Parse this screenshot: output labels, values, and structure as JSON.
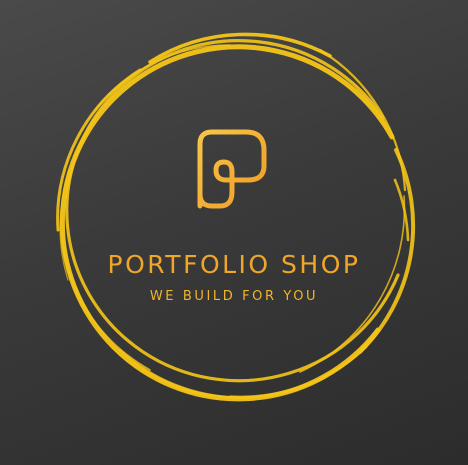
{
  "logo": {
    "brand_name": "PORTFOLIO SHOP",
    "tagline": "WE BUILD FOR YOU",
    "monogram_icon": "p-monogram-icon",
    "ring_icon": "brush-circle-icon"
  },
  "colors": {
    "background_top": "#4a4a4a",
    "background_bottom": "#2c2c2c",
    "ring": "#f5c518",
    "monogram_gradient_start": "#f7c64a",
    "monogram_gradient_end": "#ef9b22",
    "text_gold": "#f0a629"
  }
}
